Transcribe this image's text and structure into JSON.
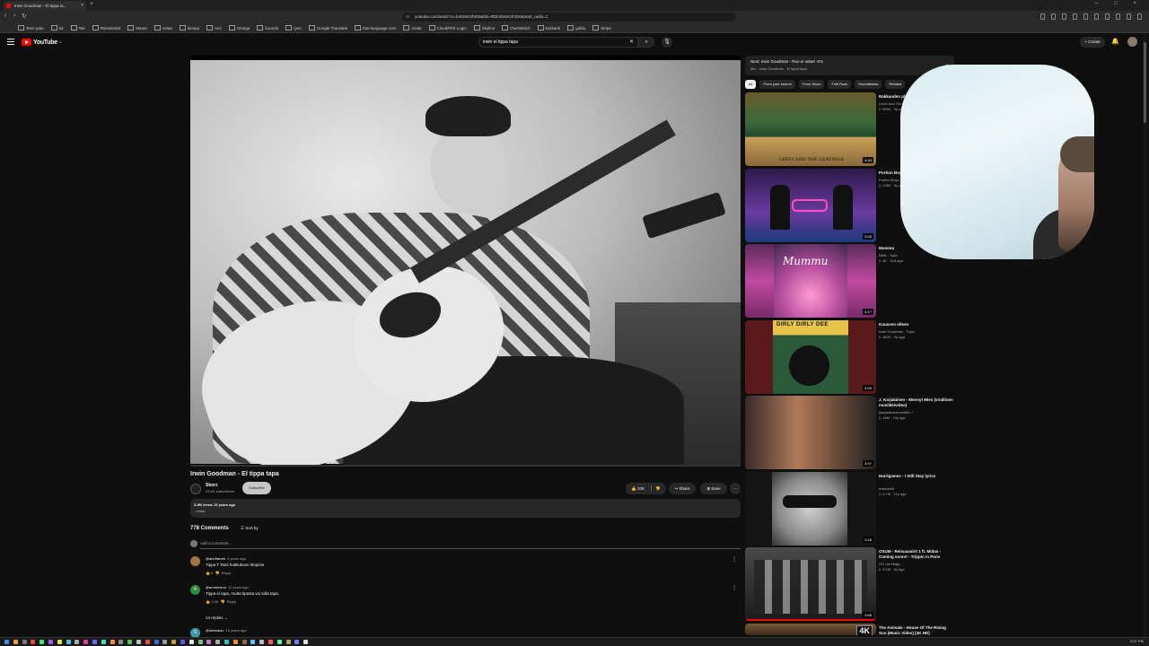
{
  "browser": {
    "tab_title": "Irwin Goodman - El tippa ta...",
    "url": "youtube.com/watch?v=lo0S6KOhlO8&list=RDlo0S6KOhlO8&start_radio=1",
    "bookmarks": [
      "Teen juttu",
      "63",
      "Tee",
      "Reisutiedot",
      "Mauto",
      "vetaa",
      "kimaar",
      "ruzi",
      "Omega",
      "bounds",
      "ryen",
      "Google Translate",
      "thai-language.com",
      "mode",
      "CloudRPS Login",
      "Skyline",
      "OverWatch",
      "kokkaek",
      "giddu",
      "Stripe"
    ]
  },
  "masthead": {
    "logo_text": "YouTube",
    "logo_region": "FI",
    "search_query": "irwin el tippa tapa",
    "create_label": "+ Create"
  },
  "video": {
    "title": "Irwin Goodman - El tippa tapa",
    "channel": "Skorz",
    "subscribers": "23.6K subscribers",
    "subscribe_label": "Subscribe",
    "likes": "10K",
    "share_label": "Share",
    "save_label": "Save",
    "views_date": "3.9M views  15 years ago",
    "more_label": "...more"
  },
  "comments": {
    "count": "778 Comments",
    "sort_label": "Sort by",
    "add_placeholder": "Add a comment...",
    "items": [
      {
        "author": "@abuftarrek",
        "age": "5 years ago",
        "text": "Tippa T Tanti hukkukoon ilmpiriin",
        "likes": "6",
        "reply": "Reply",
        "color": "#a0763a"
      },
      {
        "author": "@aromimmo",
        "age": "11 years ago",
        "text": "Tippa ei tapa, mutta tipasta voi tulla tapa.",
        "likes": "1.5K",
        "reply": "Reply",
        "color": "#2e8b3a"
      },
      {
        "author": "@siewiaulo",
        "age": "10 years ago",
        "text": "",
        "likes": "",
        "reply": "",
        "color": "#3a9aa8"
      }
    ],
    "replies_label": "14 replies"
  },
  "sidebar": {
    "next_title": "Next: Irwin Goodman - Ruo ei ratset -0:6",
    "next_sub": "Mix - Irwin Goodman - El tippa tapa",
    "chips": [
      "All",
      "From your search",
      "From Skorz",
      "Folk Rock",
      "Soundtracks",
      "Related"
    ],
    "recs": [
      {
        "title": "Rakkauden planeetta",
        "channel": "Leevi And The Leavings",
        "meta": "▷ 550K · 5y ago",
        "duration": "4:44",
        "cover_text": "LEEVI AND THE LEAVINGS"
      },
      {
        "title": "Portion Boys - Kiikkuy",
        "channel": "Portion Boys",
        "meta": "▷ 136K · 5y ago",
        "duration": "3:45",
        "cover_text": ""
      },
      {
        "title": "Mummu",
        "channel": "Eliitti - Topic",
        "meta": "▷ 4K · 11d ago",
        "duration": "4:17",
        "cover_text": "Mummu"
      },
      {
        "title": "Kuussen olleen",
        "channel": "Irwin Goodman - Topic",
        "meta": "▷ 362K · 9y ago",
        "duration": "4:00",
        "cover_text": "DIRLY DIRLY DEE"
      },
      {
        "title": "J. Karjalainen - Mennyt Mies (virallinen musiikkivideo)",
        "channel": "jkarjalainenmusiikki ✓",
        "meta": "▷ 14M · 13y ago",
        "duration": "4:47",
        "cover_text": ""
      },
      {
        "title": "Harrigames - I Still Stay lyrics",
        "channel": "matsumik",
        "meta": "▷ 4.7M · 11y ago",
        "duration": "3:28",
        "cover_text": ""
      },
      {
        "title": "OSUM - Reisuaasiirt 1 ft. Midas - Coming soon!! - Trippin in Paris",
        "channel": "OS Ula Maija",
        "meta": "▷ 9.1M · 9y ago",
        "duration": "3:58",
        "cover_text": ""
      },
      {
        "title": "The Animals - House Of The Rising Sun (Music Video) [4K HD]",
        "channel": "",
        "meta": "",
        "duration": "",
        "cover_text": "4K"
      }
    ]
  },
  "taskbar": {
    "clock": "9:37 PM"
  }
}
